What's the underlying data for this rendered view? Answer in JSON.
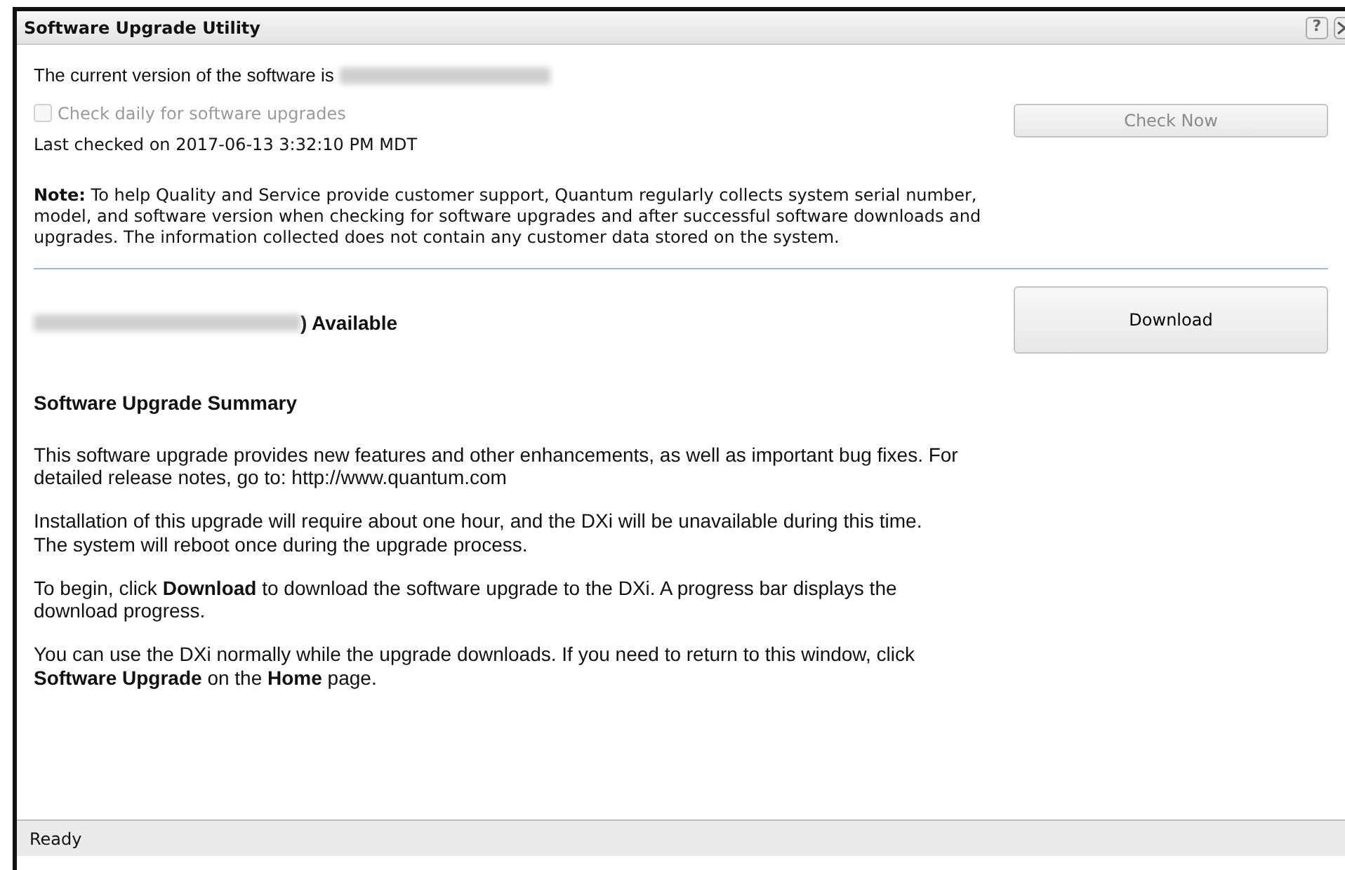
{
  "window": {
    "title": "Software Upgrade Utility",
    "help_button": "?"
  },
  "current": {
    "label": "The current version of the software is"
  },
  "check_daily": {
    "label": "Check daily for software upgrades",
    "checked": false,
    "disabled": true
  },
  "check_now_button": {
    "label": "Check Now",
    "disabled": true
  },
  "last_checked": "Last checked on 2017-06-13 3:32:10 PM MDT",
  "note": "**Note:** To help Quality and Service provide customer support, Quantum regularly collects system serial number, model, and software version when checking for software upgrades and after successful software downloads and upgrades. The information collected does not contain any customer data stored on the system.",
  "available": {
    "suffix": ") Available"
  },
  "download_button": {
    "label": "Download",
    "disabled": false
  },
  "summary_title": "Software Upgrade Summary",
  "paragraphs": [
    "This software upgrade provides new features and other enhancements, as well as important bug fixes. For detailed release notes, go to: http://www.quantum.com",
    "Installation of this upgrade will require about one hour, and the DXi will be unavailable during this time. The system will reboot once during the upgrade process.",
    "To begin, click **Download** to download the software upgrade to the DXi. A progress bar displays the download progress.",
    "You can use the DXi normally while the upgrade downloads. If you need to return to this window, click **Software Upgrade** on the **Home** page."
  ],
  "status_bar": "Ready"
}
